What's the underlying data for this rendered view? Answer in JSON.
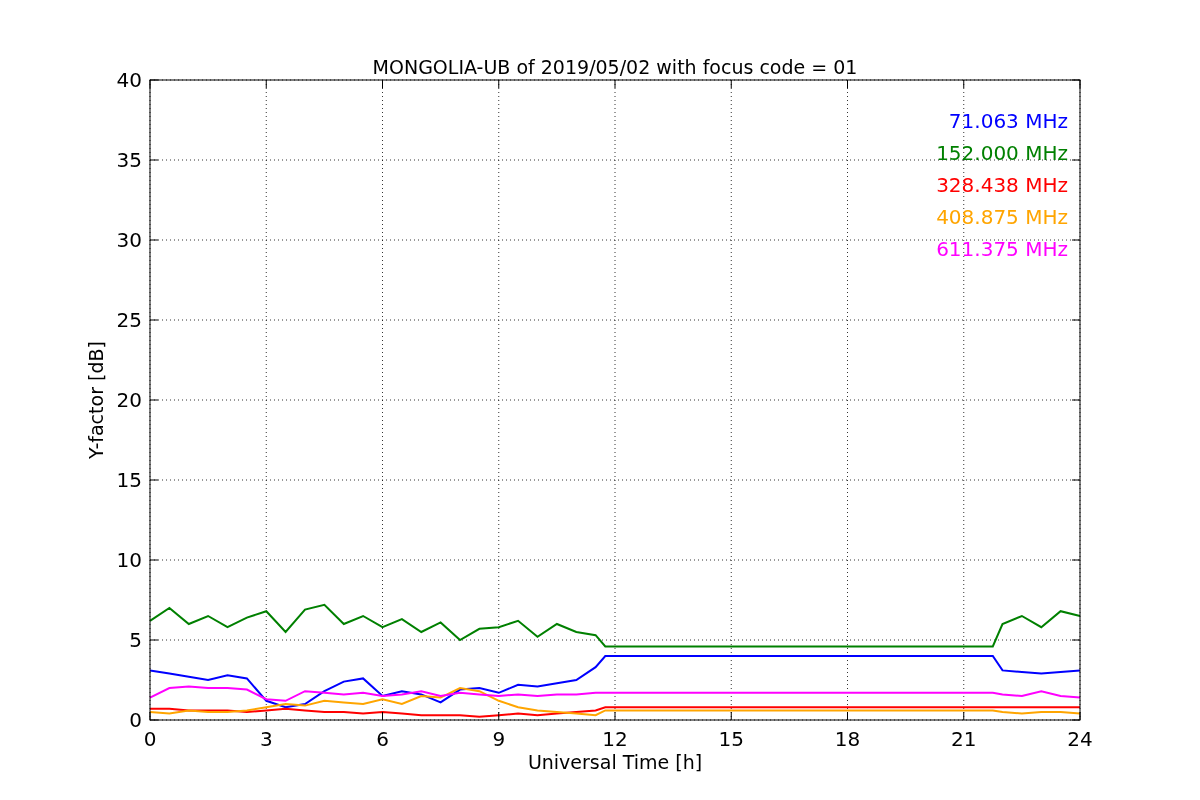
{
  "chart_data": {
    "type": "line",
    "title": "MONGOLIA-UB of 2019/05/02 with focus code = 01",
    "xlabel": "Universal Time [h]",
    "ylabel": "Y-factor [dB]",
    "x": [
      0,
      0.5,
      1,
      1.5,
      2,
      2.5,
      3,
      3.5,
      4,
      4.5,
      5,
      5.5,
      6,
      6.5,
      7,
      7.5,
      8,
      8.5,
      9,
      9.5,
      10,
      10.5,
      11,
      11.5,
      11.75,
      21.75,
      22,
      22.5,
      23,
      23.5,
      24
    ],
    "series": [
      {
        "name": "71.063 MHz",
        "color": "#0000ff",
        "values": [
          3.1,
          2.9,
          2.7,
          2.5,
          2.8,
          2.6,
          1.2,
          0.8,
          1.0,
          1.8,
          2.4,
          2.6,
          1.5,
          1.8,
          1.6,
          1.1,
          1.9,
          2.0,
          1.7,
          2.2,
          2.1,
          2.3,
          2.5,
          3.3,
          4.0,
          4.0,
          3.1,
          3.0,
          2.9,
          3.0,
          3.1
        ]
      },
      {
        "name": "152.000 MHz",
        "color": "#008000",
        "values": [
          6.2,
          7.0,
          6.0,
          6.5,
          5.8,
          6.4,
          6.8,
          5.5,
          6.9,
          7.2,
          6.0,
          6.5,
          5.8,
          6.3,
          5.5,
          6.1,
          5.0,
          5.7,
          5.8,
          6.2,
          5.2,
          6.0,
          5.5,
          5.3,
          4.6,
          4.6,
          6.0,
          6.5,
          5.8,
          6.8,
          6.5
        ]
      },
      {
        "name": "328.438 MHz",
        "color": "#ff0000",
        "values": [
          0.7,
          0.7,
          0.6,
          0.6,
          0.6,
          0.5,
          0.6,
          0.7,
          0.6,
          0.5,
          0.5,
          0.4,
          0.5,
          0.4,
          0.3,
          0.3,
          0.3,
          0.2,
          0.3,
          0.4,
          0.3,
          0.4,
          0.5,
          0.6,
          0.8,
          0.8,
          0.8,
          0.8,
          0.8,
          0.8,
          0.8
        ]
      },
      {
        "name": "408.875 MHz",
        "color": "#ffa500",
        "values": [
          0.5,
          0.4,
          0.6,
          0.5,
          0.5,
          0.6,
          0.8,
          1.0,
          0.9,
          1.2,
          1.1,
          1.0,
          1.3,
          1.0,
          1.5,
          1.4,
          2.0,
          1.8,
          1.2,
          0.8,
          0.6,
          0.5,
          0.4,
          0.3,
          0.6,
          0.6,
          0.5,
          0.4,
          0.5,
          0.5,
          0.4
        ]
      },
      {
        "name": "611.375 MHz",
        "color": "#ff00ff",
        "values": [
          1.4,
          2.0,
          2.1,
          2.0,
          2.0,
          1.9,
          1.3,
          1.2,
          1.8,
          1.7,
          1.6,
          1.7,
          1.5,
          1.6,
          1.8,
          1.5,
          1.7,
          1.6,
          1.5,
          1.6,
          1.5,
          1.6,
          1.6,
          1.7,
          1.7,
          1.7,
          1.6,
          1.5,
          1.8,
          1.5,
          1.4
        ]
      }
    ],
    "xlim": [
      0,
      24
    ],
    "ylim": [
      0,
      40
    ],
    "xticks": [
      0,
      3,
      6,
      9,
      12,
      15,
      18,
      21,
      24
    ],
    "yticks": [
      0,
      5,
      10,
      15,
      20,
      25,
      30,
      35,
      40
    ],
    "grid": true
  }
}
